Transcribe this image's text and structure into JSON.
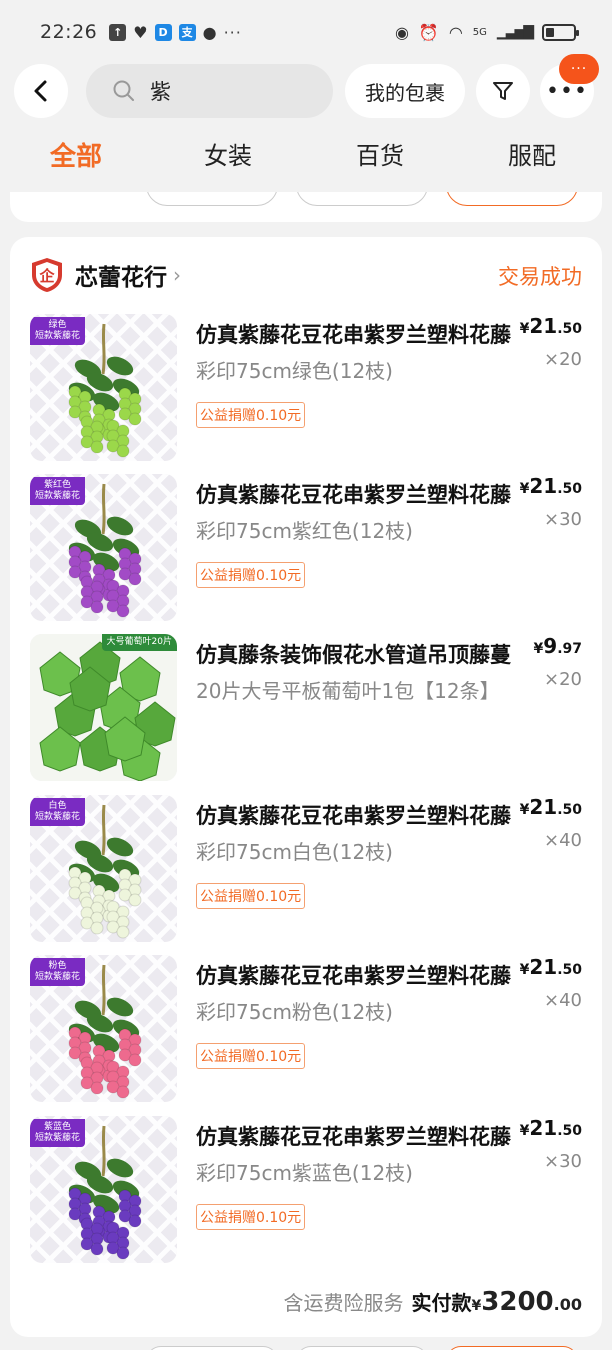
{
  "status_bar": {
    "time": "22:26",
    "network": "5G",
    "dots": "···"
  },
  "search": {
    "query": "紫"
  },
  "header": {
    "package_label": "我的包裹",
    "badge": "···"
  },
  "tabs": [
    {
      "label": "全部",
      "active": true
    },
    {
      "label": "女装",
      "active": false
    },
    {
      "label": "百货",
      "active": false
    },
    {
      "label": "服配",
      "active": false
    }
  ],
  "order": {
    "shop_name": "芯蕾花行",
    "shop_badge": "企",
    "status": "交易成功",
    "items": [
      {
        "title": "仿真紫藤花豆花串紫罗兰塑料花藤",
        "spec": "彩印75cm绿色(12枝)",
        "charity": "公益捐赠0.10元",
        "yen": "¥",
        "price_int": "21",
        "price_dec": ".50",
        "qty": "×20",
        "tag": "绿色\n短款紫藤花",
        "flower_color": "#9bd84a"
      },
      {
        "title": "仿真紫藤花豆花串紫罗兰塑料花藤",
        "spec": "彩印75cm紫红色(12枝)",
        "charity": "公益捐赠0.10元",
        "yen": "¥",
        "price_int": "21",
        "price_dec": ".50",
        "qty": "×30",
        "tag": "紫红色\n短款紫藤花",
        "flower_color": "#a24bc6"
      },
      {
        "title": "仿真藤条装饰假花水管道吊顶藤蔓",
        "spec": "20片大号平板葡萄叶1包【12条】",
        "charity": "",
        "yen": "¥",
        "price_int": "9",
        "price_dec": ".97",
        "qty": "×20",
        "tag": "大号葡萄叶20片",
        "flower_color": ""
      },
      {
        "title": "仿真紫藤花豆花串紫罗兰塑料花藤",
        "spec": "彩印75cm白色(12枝)",
        "charity": "公益捐赠0.10元",
        "yen": "¥",
        "price_int": "21",
        "price_dec": ".50",
        "qty": "×40",
        "tag": "白色\n短款紫藤花",
        "flower_color": "#eef5dc"
      },
      {
        "title": "仿真紫藤花豆花串紫罗兰塑料花藤",
        "spec": "彩印75cm粉色(12枝)",
        "charity": "公益捐赠0.10元",
        "yen": "¥",
        "price_int": "21",
        "price_dec": ".50",
        "qty": "×40",
        "tag": "粉色\n短款紫藤花",
        "flower_color": "#ee6a8e"
      },
      {
        "title": "仿真紫藤花豆花串紫罗兰塑料花藤",
        "spec": "彩印75cm紫蓝色(12枝)",
        "charity": "公益捐赠0.10元",
        "yen": "¥",
        "price_int": "21",
        "price_dec": ".50",
        "qty": "×30",
        "tag": "紫蓝色\n短款紫藤花",
        "flower_color": "#6a3bbf"
      }
    ],
    "total": {
      "service_text": "含运费险服务",
      "label": "实付款",
      "yen": "¥",
      "amount_int": "3200",
      "amount_dec": ".00"
    }
  },
  "colors": {
    "accent": "#f26b25",
    "background": "#f2f2f2"
  }
}
